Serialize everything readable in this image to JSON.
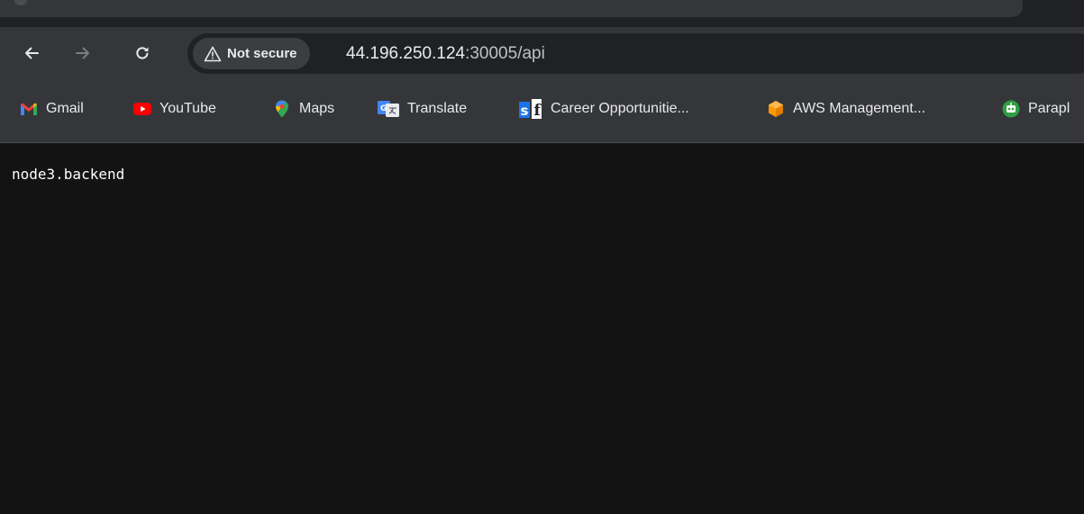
{
  "toolbar": {
    "back_icon": "arrow-left-icon",
    "forward_icon": "arrow-right-icon",
    "reload_icon": "reload-icon",
    "security_label": "Not secure",
    "security_icon": "warning-triangle-icon",
    "url_host": "44.196.250.124",
    "url_port_path": ":30005/api"
  },
  "bookmarks": {
    "items": [
      {
        "label": "Gmail",
        "icon": "gmail-icon"
      },
      {
        "label": "YouTube",
        "icon": "youtube-icon"
      },
      {
        "label": "Maps",
        "icon": "maps-icon"
      },
      {
        "label": "Translate",
        "icon": "translate-icon"
      },
      {
        "label": "Career Opportunitie...",
        "icon": "sf-icon"
      },
      {
        "label": "AWS Management...",
        "icon": "aws-icon"
      },
      {
        "label": "Parapl",
        "icon": "paraphraser-icon"
      }
    ]
  },
  "page": {
    "body_text": "node3.backend"
  },
  "colors": {
    "toolbar_bg": "#35363a",
    "omnibox_bg": "#202124",
    "page_bg": "#131313",
    "youtube_red": "#ff0000",
    "aws_orange": "#ff9900"
  }
}
